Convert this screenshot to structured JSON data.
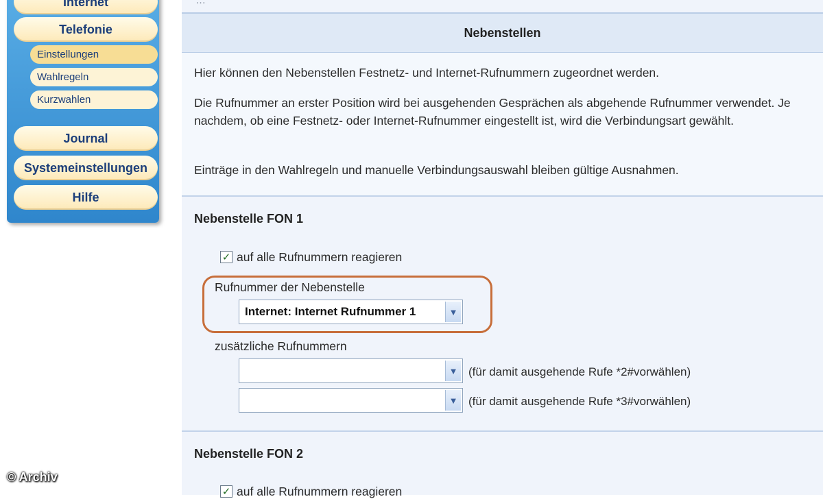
{
  "sidebar": {
    "items": [
      {
        "label": "Internet"
      },
      {
        "label": "Telefonie"
      },
      {
        "label": "Einstellungen"
      },
      {
        "label": "Wahlregeln"
      },
      {
        "label": "Kurzwahlen"
      },
      {
        "label": "Journal"
      },
      {
        "label": "Systemeinstellungen"
      },
      {
        "label": "Hilfe"
      }
    ]
  },
  "main": {
    "top_strip_text": "…",
    "section_title": "Nebenstellen",
    "intro": [
      "Hier können den Nebenstellen Festnetz- und Internet-Rufnummern zugeordnet werden.",
      "Die Rufnummer an erster Position wird bei ausgehenden Gesprächen als abgehende Rufnummer verwendet. Je nachdem, ob eine Festnetz- oder Internet-Rufnummer eingestellt ist, wird die Verbindungsart gewählt.",
      "Einträge in den Wahlregeln und manuelle Verbindungsauswahl bleiben gültige Ausnahmen."
    ],
    "fon1": {
      "title": "Nebenstelle FON 1",
      "checkbox_label": "auf alle Rufnummern reagieren",
      "checked": true,
      "number_label": "Rufnummer der Nebenstelle",
      "number_value": "Internet: Internet Rufnummer 1",
      "additional_label": "zusätzliche Rufnummern",
      "additional": [
        {
          "value": "",
          "hint": "(für damit ausgehende Rufe *2#vorwählen)"
        },
        {
          "value": "",
          "hint": "(für damit ausgehende Rufe *3#vorwählen)"
        }
      ]
    },
    "fon2": {
      "title": "Nebenstelle FON 2",
      "checkbox_label": "auf alle Rufnummern reagieren",
      "checked": true
    }
  },
  "watermark": "© Archiv",
  "colors": {
    "sidebar": "#2f86cc",
    "nav_button": "#fde9b8",
    "nav_active": "#f7dd95",
    "highlight": "#c76e3a",
    "header_bg": "#dfe9f6"
  },
  "icons": {
    "checkbox": "checkmark-icon",
    "dropdown": "chevron-down-icon"
  }
}
